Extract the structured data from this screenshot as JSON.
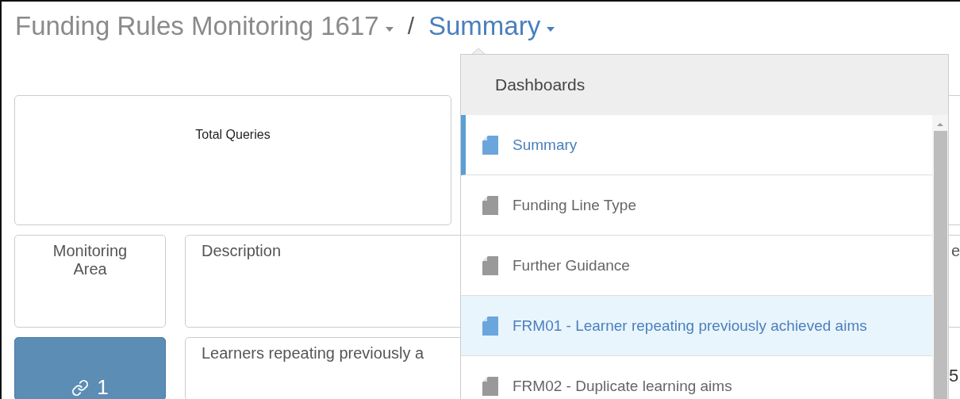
{
  "breadcrumb": {
    "workbook": "Funding Rules Monitoring 1617",
    "separator": "/",
    "current": "Summary"
  },
  "dropdown": {
    "header": "Dashboards",
    "items": [
      {
        "label": "Summary",
        "selected": true,
        "highlighted": false
      },
      {
        "label": "Funding Line Type",
        "selected": false,
        "highlighted": false
      },
      {
        "label": "Further Guidance",
        "selected": false,
        "highlighted": false
      },
      {
        "label": "FRM01 - Learner repeating previously achieved aims",
        "selected": false,
        "highlighted": true
      },
      {
        "label": "FRM02 - Duplicate learning aims",
        "selected": false,
        "highlighted": false
      }
    ]
  },
  "total_queries": {
    "title": "Total Queries"
  },
  "columns": {
    "monitoring_area": "Monitoring Area",
    "description": "Description",
    "column_3": "e"
  },
  "rows": [
    {
      "area": "1",
      "description": "Learners repeating previously a",
      "column_3": "5"
    }
  ]
}
